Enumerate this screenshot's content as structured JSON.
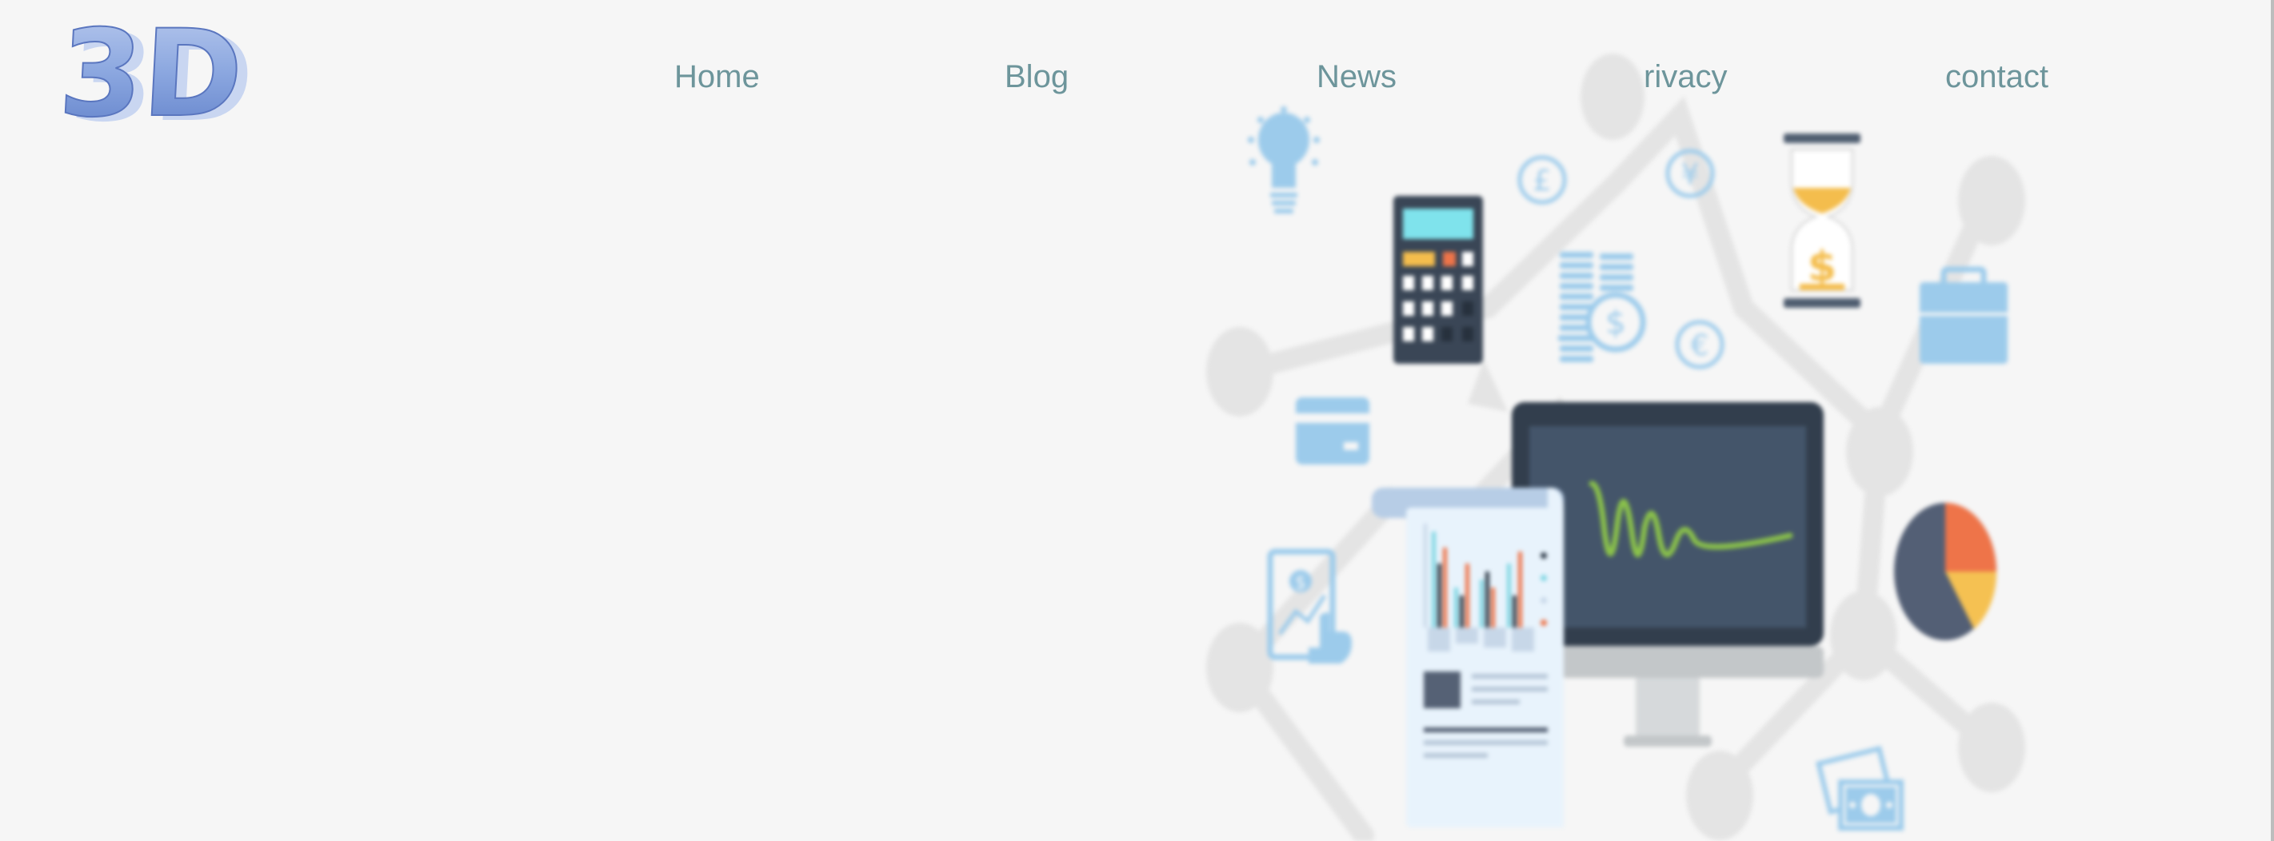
{
  "logo": {
    "text": "3D"
  },
  "nav": {
    "items": [
      {
        "label": "Home"
      },
      {
        "label": "Blog"
      },
      {
        "label": "News"
      },
      {
        "label": "rivacy"
      },
      {
        "label": "contact"
      }
    ]
  },
  "hero": {
    "currency_symbols": {
      "pound": "£",
      "yen": "¥",
      "dollar": "$",
      "euro": "€"
    }
  },
  "colors": {
    "background": "#f6f6f6",
    "nav_text": "#6d959b",
    "logo_blue": "#6f8fd8",
    "icon_blue": "#9ccbeb",
    "monitor_dark": "#2f3b48",
    "chart_green": "#8bc34a",
    "accent_orange": "#ee7449",
    "accent_yellow": "#f5c152",
    "network_gray": "#e3e3e3"
  }
}
